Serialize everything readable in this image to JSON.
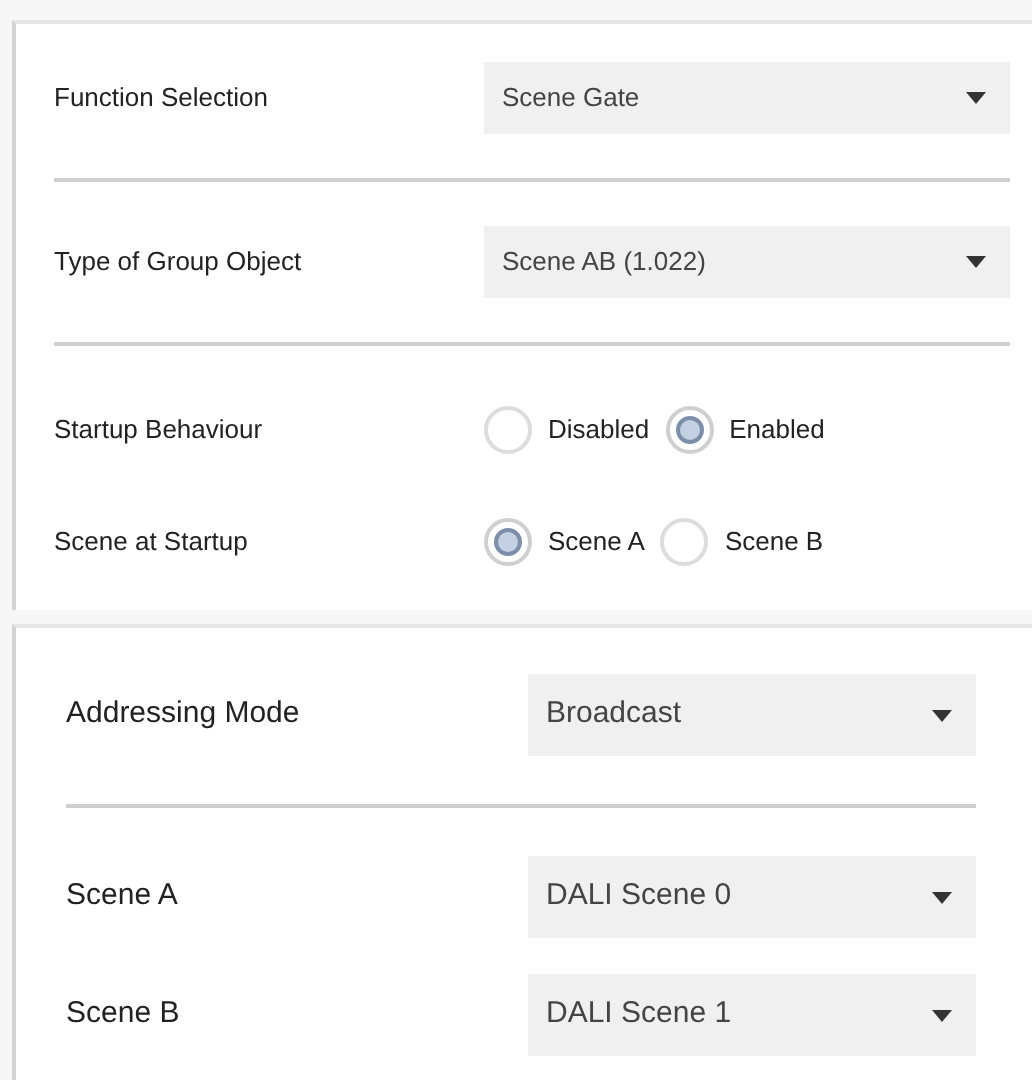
{
  "panels": [
    {
      "kind": "compact",
      "groups": [
        [
          {
            "kind": "dropdown",
            "label": "Function Selection",
            "value": "Scene Gate"
          }
        ],
        [
          {
            "kind": "dropdown",
            "label": "Type of Group Object",
            "value": "Scene AB (1.022)"
          }
        ],
        [
          {
            "kind": "radio",
            "label": "Startup Behaviour",
            "options": [
              {
                "label": "Disabled",
                "selected": false
              },
              {
                "label": "Enabled",
                "selected": true
              }
            ]
          },
          {
            "kind": "radio",
            "label": "Scene at Startup",
            "options": [
              {
                "label": "Scene A",
                "selected": true
              },
              {
                "label": "Scene B",
                "selected": false
              }
            ]
          }
        ]
      ]
    },
    {
      "kind": "roomy",
      "groups": [
        [
          {
            "kind": "dropdown",
            "label": "Addressing Mode",
            "value": "Broadcast"
          }
        ],
        [
          {
            "kind": "dropdown",
            "label": "Scene A",
            "value": "DALI Scene 0"
          },
          {
            "kind": "dropdown",
            "label": "Scene B",
            "value": "DALI Scene 1"
          }
        ]
      ]
    }
  ]
}
